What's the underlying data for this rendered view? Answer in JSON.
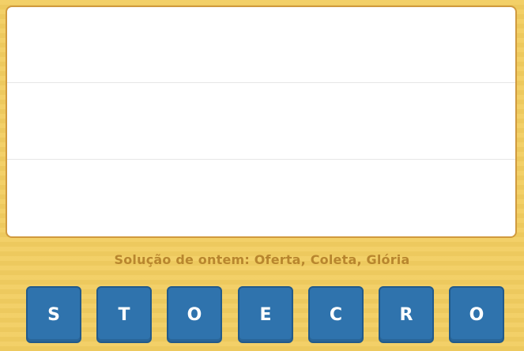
{
  "board": {
    "rows": [
      "",
      "",
      ""
    ]
  },
  "hint": {
    "text": "Solução de ontem: Oferta, Coleta, Glória"
  },
  "tiles": [
    {
      "letter": "S"
    },
    {
      "letter": "T"
    },
    {
      "letter": "O"
    },
    {
      "letter": "E"
    },
    {
      "letter": "C"
    },
    {
      "letter": "R"
    },
    {
      "letter": "O"
    }
  ],
  "colors": {
    "background": "#f2cd60",
    "board_border": "#d09a3e",
    "tile": "#2f73ad",
    "hint_text": "#b8862e"
  }
}
